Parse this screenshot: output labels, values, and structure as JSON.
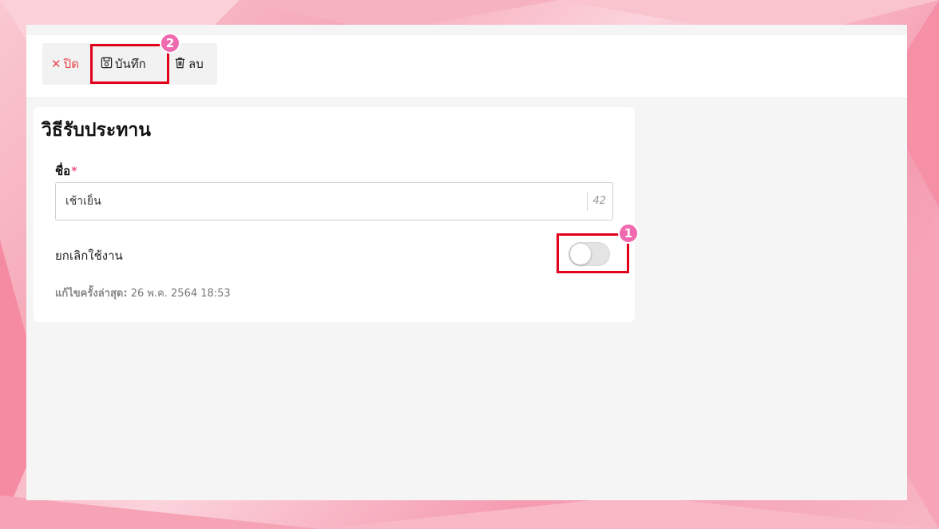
{
  "toolbar": {
    "close_label": "ปิด",
    "save_label": "บันทึก",
    "delete_label": "ลบ"
  },
  "card": {
    "title": "วิธีรับประทาน"
  },
  "name_field": {
    "label": "ชื่อ",
    "required_mark": "*",
    "value": "เช้าเย็น",
    "char_counter": "42"
  },
  "cancel_toggle": {
    "label": "ยกเลิกใช้งาน",
    "state": "off"
  },
  "last_edit": {
    "label": "แก้ไขครั้งล่าสุด:",
    "value": "26 พ.ค. 2564 18:53"
  },
  "annotations": [
    {
      "number": "1",
      "target": "cancel-toggle"
    },
    {
      "number": "2",
      "target": "save-button"
    }
  ],
  "colors": {
    "highlight": "#e3001b",
    "badge": "#f06ab0",
    "close_accent": "#e5464d",
    "required_mark": "#e0245e"
  }
}
